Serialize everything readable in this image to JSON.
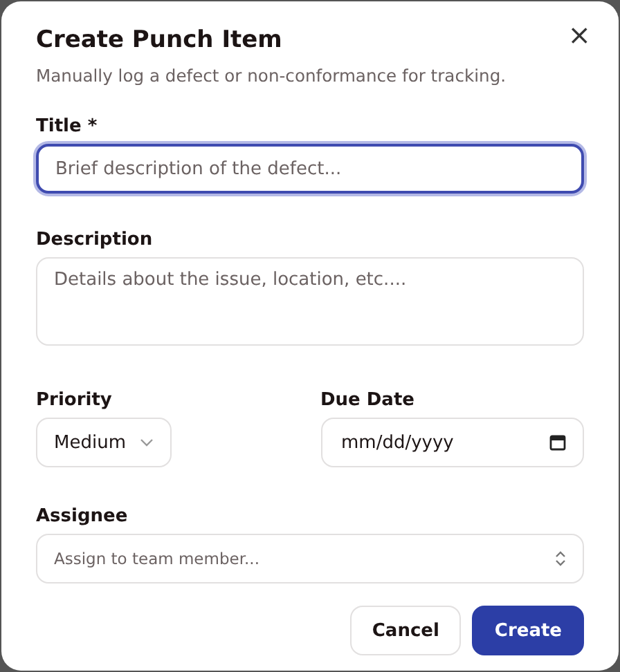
{
  "dialog": {
    "title": "Create Punch Item",
    "subtitle": "Manually log a defect or non-conformance for tracking.",
    "close": "×"
  },
  "fields": [
    {
      "kind": "text",
      "label": "Title *",
      "placeholder": "Brief description of the defect...",
      "focused": true
    },
    {
      "kind": "textarea",
      "label": "Description",
      "placeholder": "Details about the issue, location, etc...."
    }
  ],
  "row": [
    {
      "kind": "select",
      "label": "Priority",
      "value": "Medium"
    },
    {
      "kind": "date",
      "label": "Due Date",
      "value": "mm/dd/yyyy"
    }
  ],
  "assignee": {
    "label": "Assignee",
    "placeholder": "Assign to team member..."
  },
  "buttons": [
    {
      "label": "Cancel",
      "primary": false
    },
    {
      "label": "Create",
      "primary": true
    }
  ]
}
